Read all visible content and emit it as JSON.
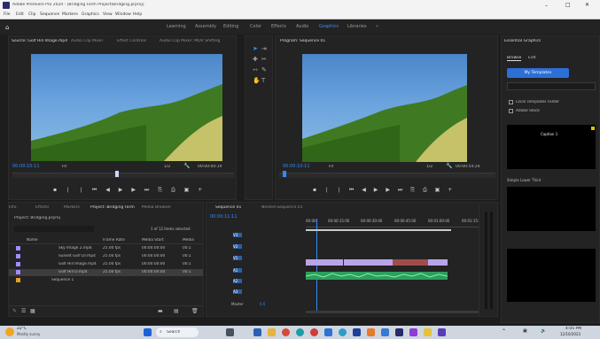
{
  "app": {
    "title": "Adobe Premiere Pro 2020 - [Bridging Farm Project\\Bridging.prproj]",
    "menu": [
      "File",
      "Edit",
      "Clip",
      "Sequence",
      "Markers",
      "Graphics",
      "View",
      "Window",
      "Help"
    ]
  },
  "workspaces": [
    "Learning",
    "Assembly",
    "Editing",
    "Color",
    "Effects",
    "Audio",
    "Graphics",
    "Libraries",
    "»"
  ],
  "source": {
    "tabs": [
      "Source: Golf Hill Image.mp4",
      "Audio Clip Mixer",
      "Effect Controls",
      "Audio Clip Mixer: MOV Shifting"
    ],
    "timecode": "00:00:10:11",
    "fit": "Fit",
    "dur": "00:00:00:19",
    "frac": "1/2"
  },
  "program": {
    "tabs": [
      "Program: Sequence 01"
    ],
    "timecode": "00:00:10:11",
    "fit": "Fit",
    "dur": "00:00:54:24",
    "frac": "1/2"
  },
  "effects": {
    "tabs": [
      "Essential Graphics",
      "Edit"
    ],
    "browse": "Browse",
    "edit": "Edit",
    "my_templates": "My Templates",
    "local_templates": "Local Templates Folder",
    "adobe_stock": "Adobe Stock",
    "thumbs": [
      "Caption 1",
      "",
      "Simple Lower Third"
    ]
  },
  "project": {
    "tabs": [
      "Info",
      "Effects",
      "Markers",
      "Project: Bridging Farm",
      "Media Browser",
      "Libraries"
    ],
    "path": "Project: Bridging.prproj",
    "item_count": "1 of 12 items selected",
    "columns": [
      "Name",
      "Frame Rate",
      "Media Start",
      "Media"
    ],
    "rows": [
      [
        "Sky Image 2.mp4",
        "25.00 fps",
        "00:00:00:00",
        "00:1"
      ],
      [
        "Sunset Golf Dr.mp4",
        "25.00 fps",
        "00:00:00:00",
        "00:1"
      ],
      [
        "Golf Hill Image.mp4",
        "25.00 fps",
        "00:00:00:00",
        "00:1"
      ],
      [
        "Golf Hill D.mp4",
        "25.00 fps",
        "00:00:00:00",
        "00:1"
      ],
      [
        "Sequence 1",
        "",
        "",
        ""
      ]
    ]
  },
  "timeline": {
    "tabs": [
      "Sequence 01",
      "Nested Sequence 01"
    ],
    "timecode": "00:00:11:11",
    "ruler": [
      "00:00",
      "00:00:15:00",
      "00:00:30:00",
      "00:00:45:00",
      "00:01:00:00",
      "00:01:15:00"
    ],
    "tracks": [
      "V3",
      "V2",
      "V1",
      "A1",
      "A2",
      "A3",
      "Master"
    ],
    "master": "0.0"
  },
  "taskbar": {
    "weather_temp": "22°C",
    "weather_desc": "Mostly sunny",
    "search": "Search",
    "time": "4:05 PM",
    "date": "12/10/2023"
  }
}
